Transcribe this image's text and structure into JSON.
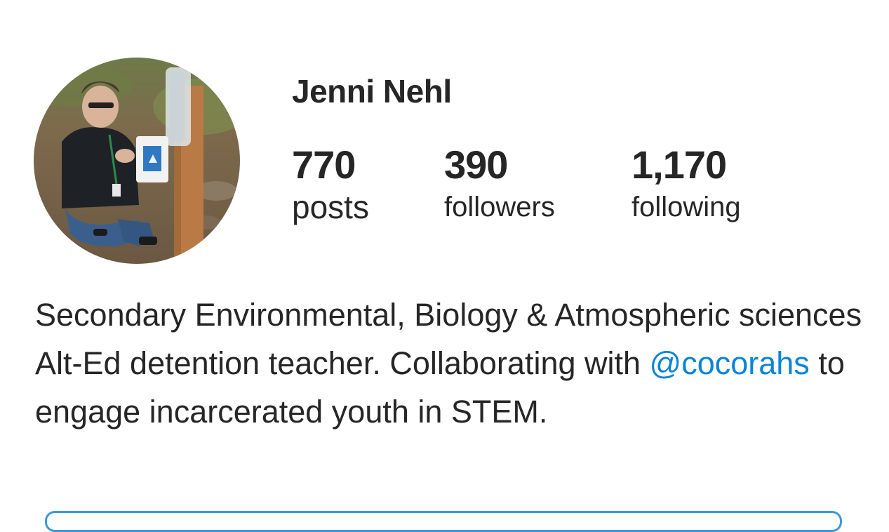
{
  "profile": {
    "username": "Jenni Nehl",
    "avatar_alt": "profile photo",
    "stats": {
      "posts": {
        "count": "770",
        "label": "posts"
      },
      "followers": {
        "count": "390",
        "label": "followers"
      },
      "following": {
        "count": "1,170",
        "label": "following"
      }
    },
    "bio": {
      "before_mention": "Secondary Environmental, Biology & Atmospheric sciences Alt-Ed detention teacher. Collaborating with ",
      "mention": "@cocorahs",
      "after_mention": " to engage incarcerated youth in STEM."
    }
  },
  "colors": {
    "text": "#262626",
    "mention": "#0a84d8",
    "button_border": "#3a9ad9"
  }
}
